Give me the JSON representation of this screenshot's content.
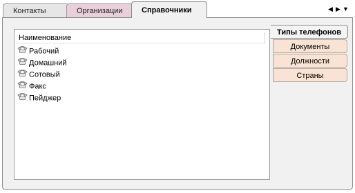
{
  "tabs": [
    {
      "label": "Контакты"
    },
    {
      "label": "Организации"
    },
    {
      "label": "Справочники"
    }
  ],
  "nav": {
    "prev": "◀",
    "next": "▶",
    "menu": "▼"
  },
  "list": {
    "header": "Наименование",
    "items": [
      {
        "label": "Рабочий",
        "icon": "phone-icon"
      },
      {
        "label": "Домашний",
        "icon": "phone-icon"
      },
      {
        "label": "Сотовый",
        "icon": "phone-icon"
      },
      {
        "label": "Факс",
        "icon": "phone-icon"
      },
      {
        "label": "Пейджер",
        "icon": "phone-icon"
      }
    ]
  },
  "side_tabs": [
    {
      "label": "Типы телефонов",
      "active": true
    },
    {
      "label": "Документы"
    },
    {
      "label": "Должности"
    },
    {
      "label": "Страны"
    }
  ],
  "colors": {
    "active_tab": "#f1f1f1",
    "orgs_tab": "#e8cfd9",
    "side_tab": "#f9e3d4"
  }
}
